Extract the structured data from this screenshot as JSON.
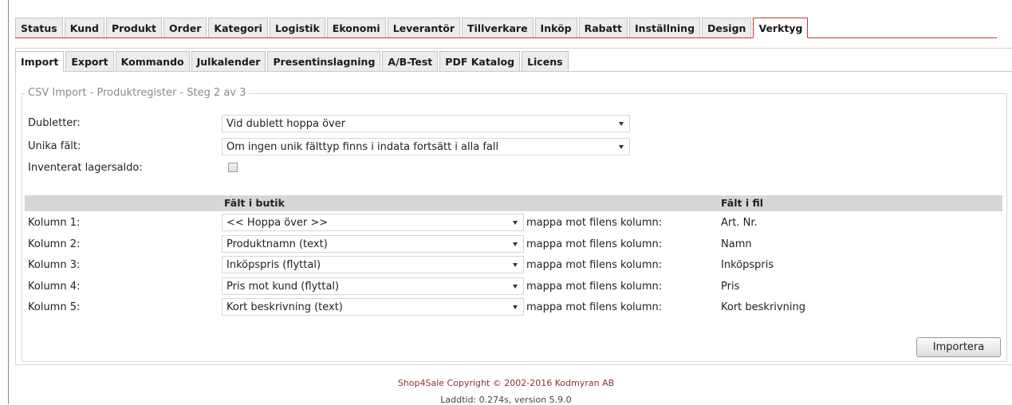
{
  "main_tabs": [
    "Status",
    "Kund",
    "Produkt",
    "Order",
    "Kategori",
    "Logistik",
    "Ekonomi",
    "Leverantör",
    "Tillverkare",
    "Inköp",
    "Rabatt",
    "Inställning",
    "Design",
    "Verktyg"
  ],
  "sub_tabs": [
    "Import",
    "Export",
    "Kommando",
    "Julkalender",
    "Presentinslagning",
    "A/B-Test",
    "PDF Katalog",
    "Licens"
  ],
  "fieldset_legend": "CSV Import - Produktregister - Steg 2 av 3",
  "options": {
    "duplicates_label": "Dubletter:",
    "duplicates_value": "Vid dublett hoppa över",
    "unique_label": "Unika fält:",
    "unique_value": "Om ingen unik fälttyp finns i indata fortsätt i alla fall",
    "inventory_label": "Inventerat lagersaldo:",
    "inventory_checked": false
  },
  "mapping": {
    "header_store": "Fält i butik",
    "header_file": "Fält i fil",
    "map_text": "mappa mot filens kolumn:",
    "rows": [
      {
        "label": "Kolumn 1:",
        "store_field": "<< Hoppa över >>",
        "file_field": "Art. Nr."
      },
      {
        "label": "Kolumn 2:",
        "store_field": "Produktnamn (text)",
        "file_field": "Namn"
      },
      {
        "label": "Kolumn 3:",
        "store_field": "Inköpspris (flyttal)",
        "file_field": "Inköpspris"
      },
      {
        "label": "Kolumn 4:",
        "store_field": "Pris mot kund (flyttal)",
        "file_field": "Pris"
      },
      {
        "label": "Kolumn 5:",
        "store_field": "Kort beskrivning (text)",
        "file_field": "Kort beskrivning"
      }
    ]
  },
  "import_button": "Importera",
  "footer": {
    "copyright": "Shop4Sale Copyright © 2002-2016 Kodmyran AB",
    "loadtime": "Laddtid: 0.274s, version 5.9.0"
  },
  "colors": {
    "active_tab_border": "#cc3333",
    "header_bar": "#d6d6d6",
    "footer_text": "#8a3333"
  }
}
